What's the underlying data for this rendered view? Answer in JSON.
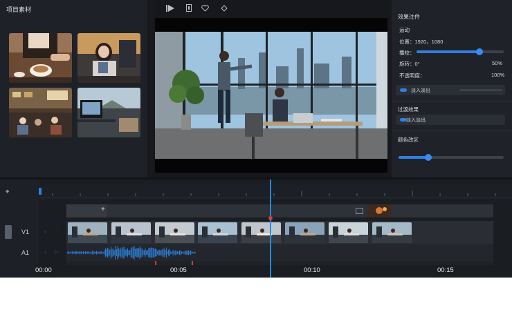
{
  "left_panel": {
    "title": "项目素材"
  },
  "viewer": {
    "play_icon": "play-icon",
    "trim_icon": "trim-bracket-icon",
    "heart_icon": "heart-icon",
    "marker_icon": "diamond-marker-icon"
  },
  "properties": {
    "title": "效果注件",
    "motion_section": "运动",
    "position_label": "位置：",
    "position_value": "1920，1080",
    "scale_label": "播校：",
    "scale_value": 0.72,
    "rotation_label": "旋转：0°",
    "rotation_pct": "50%",
    "opacity_label": "不透明度：",
    "opacity_value": "100%",
    "fade_toggle": "淡入淡出",
    "transition_section": "过渡效果",
    "transition_item": "淡入淡出",
    "color_section": "颜色改区",
    "color_value": 0.28,
    "colors": {
      "accent": "#2f80e0",
      "playhead": "#1e8cf5",
      "waveform": "#2e86e6"
    }
  },
  "timeline": {
    "v1_label": "V1",
    "a1_label": "A1",
    "timecodes": [
      "00:00",
      "00:05",
      "00:10",
      "00:15"
    ],
    "plus_icon": "plus-icon",
    "clip_count": 8
  }
}
